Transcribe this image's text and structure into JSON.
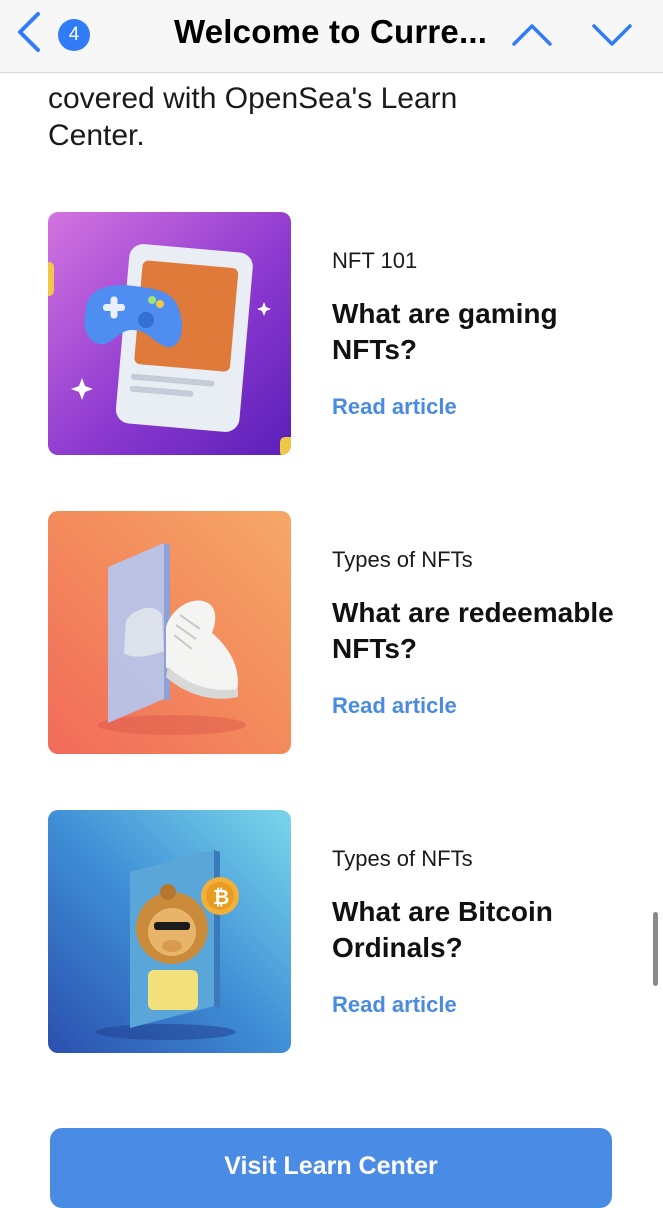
{
  "navbar": {
    "badge_count": "4",
    "title": "Welcome to Curre..."
  },
  "intro": {
    "text": "covered with OpenSea's Learn Center."
  },
  "articles": [
    {
      "category": "NFT 101",
      "title": "What are gaming NFTs?",
      "link": "Read article",
      "thumbnail": "gaming-controller-card-icon"
    },
    {
      "category": "Types of NFTs",
      "title": "What are redeemable NFTs?",
      "link": "Read article",
      "thumbnail": "sneaker-card-icon"
    },
    {
      "category": "Types of NFTs",
      "title": "What are Bitcoin Ordinals?",
      "link": "Read article",
      "thumbnail": "lion-bitcoin-card-icon"
    }
  ],
  "cta": {
    "label": "Visit Learn Center"
  },
  "colors": {
    "accent": "#2f7cf6",
    "link": "#4a8be0",
    "button": "#4a8be6"
  }
}
